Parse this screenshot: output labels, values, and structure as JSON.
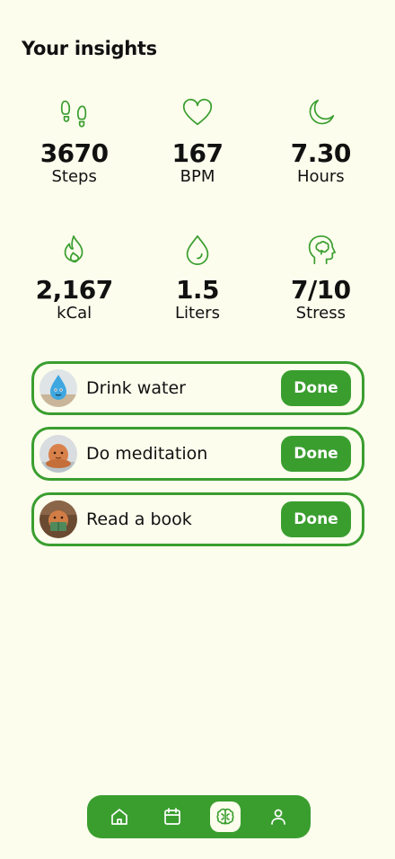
{
  "header": {
    "title": "Your insights"
  },
  "stats": [
    {
      "icon": "footsteps-icon",
      "value": "3670",
      "unit": "Steps"
    },
    {
      "icon": "heart-icon",
      "value": "167",
      "unit": "BPM"
    },
    {
      "icon": "moon-icon",
      "value": "7.30",
      "unit": "Hours"
    },
    {
      "icon": "flame-icon",
      "value": "2,167",
      "unit": "kCal"
    },
    {
      "icon": "water-drop-icon",
      "value": "1.5",
      "unit": "Liters"
    },
    {
      "icon": "head-brain-icon",
      "value": "7/10",
      "unit": "Stress"
    }
  ],
  "tasks": [
    {
      "label": "Drink water",
      "button": "Done",
      "avatar": "water-drop-character-avatar"
    },
    {
      "label": "Do meditation",
      "button": "Done",
      "avatar": "meditating-character-avatar"
    },
    {
      "label": "Read a book",
      "button": "Done",
      "avatar": "reading-character-avatar"
    }
  ],
  "nav": {
    "items": [
      "home-icon",
      "calendar-icon",
      "brain-icon",
      "profile-icon"
    ],
    "active": "brain-icon"
  },
  "colors": {
    "accent": "#3a9e2f",
    "background": "#fcfded",
    "text": "#111111"
  }
}
